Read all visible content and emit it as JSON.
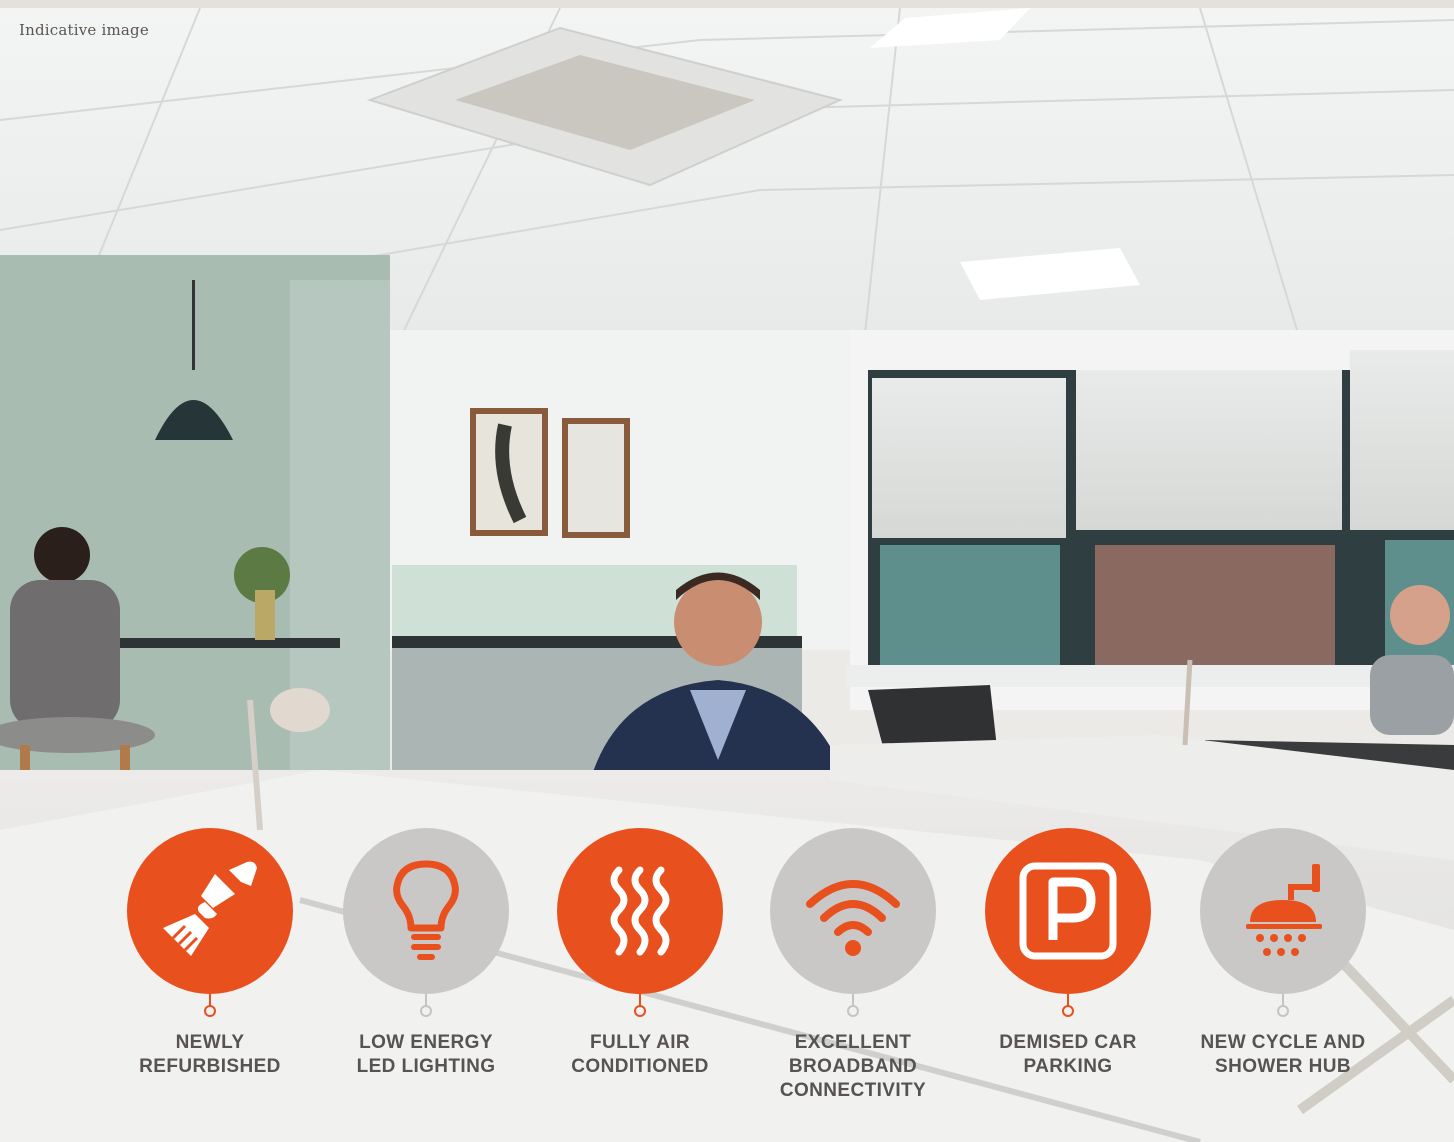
{
  "caption": "Indicative image",
  "features": [
    {
      "lines": [
        "NEWLY",
        "REFURBISHED"
      ],
      "icon": "paintbrush-icon",
      "style": "orange"
    },
    {
      "lines": [
        "LOW ENERGY",
        "LED LIGHTING"
      ],
      "icon": "lightbulb-icon",
      "style": "grey"
    },
    {
      "lines": [
        "FULLY AIR",
        "CONDITIONED"
      ],
      "icon": "air-waves-icon",
      "style": "orange"
    },
    {
      "lines": [
        "EXCELLENT",
        "BROADBAND",
        "CONNECTIVITY"
      ],
      "icon": "wifi-icon",
      "style": "grey"
    },
    {
      "lines": [
        "DEMISED CAR",
        "PARKING"
      ],
      "icon": "parking-icon",
      "style": "orange"
    },
    {
      "lines": [
        "NEW CYCLE AND",
        "SHOWER HUB"
      ],
      "icon": "shower-icon",
      "style": "grey"
    }
  ],
  "colors": {
    "accent": "#e8501e",
    "grey": "#c9c8c6",
    "label_text": "#575352"
  }
}
